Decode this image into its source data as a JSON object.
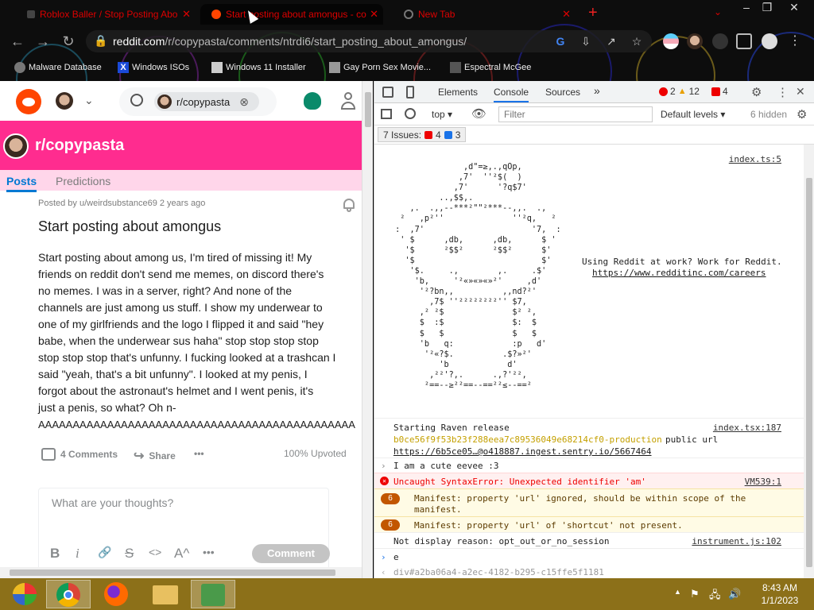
{
  "browser": {
    "tabs": [
      {
        "title": "Roblox Baller / Stop Posting Abo",
        "close": "✕"
      },
      {
        "title": "Start posting about amongus - co",
        "close": "✕"
      },
      {
        "title": "New Tab",
        "close": "✕"
      }
    ],
    "new_tab": "+",
    "window_controls": {
      "minimize": "–",
      "maximize": "❐",
      "close": "✕"
    },
    "tab_search": "⌄",
    "nav": {
      "back": "←",
      "forward": "→",
      "reload": "↻"
    },
    "url_host": "reddit.com",
    "url_path": "/r/copypasta/comments/ntrdi6/start_posting_about_amongus/",
    "bookmarks": [
      {
        "label": "Malware Database"
      },
      {
        "label": "Windows ISOs"
      },
      {
        "label": "Windows 11 Installer"
      },
      {
        "label": "Gay Porn Sex Movie..."
      },
      {
        "label": "Espectral McGee"
      }
    ]
  },
  "reddit": {
    "search_chip": "r/copypasta",
    "search_chip_clear": "⊗",
    "subreddit": "r/copypasta",
    "tabs": [
      {
        "label": "Posts"
      },
      {
        "label": "Predictions"
      }
    ],
    "post_meta": "Posted by u/weirdsubstance69 2 years ago",
    "post_title": "Start posting about amongus",
    "post_body_lines": [
      "Start posting about among us, I'm tired of missing it! My",
      "friends on reddit don't send me memes, on discord there's",
      "no memes. I was in a server, right? And none of the",
      "channels are just among us stuff. I show my underwear to",
      "one of my girlfriends and the logo I flipped it and said \"hey",
      "babe, when the underwear sus haha\" stop stop stop stop",
      "stop stop stop that's unfunny. I fucking looked at a trashcan I",
      "said \"yeah, that's a bit unfunny\". I looked at my penis, I",
      "forgot about the astronaut's helmet and I went penis, it's",
      "just a penis, so what? Oh n-",
      "AAAAAAAAAAAAAAAAAAAAAAAAAAAAAAAAAAAAAAAAAAAAAA"
    ],
    "comments_label": "4 Comments",
    "share_label": "Share",
    "more_label": "•••",
    "upvoted": "100% Upvoted",
    "comment_placeholder": "What are your thoughts?",
    "toolbar": {
      "bold": "B",
      "italic": "i",
      "link": "🔗",
      "strike": "S",
      "code": "<>",
      "superscript": "A^",
      "more": "•••"
    },
    "comment_button": "Comment"
  },
  "devtools": {
    "tabs": [
      {
        "label": "Elements"
      },
      {
        "label": "Console"
      },
      {
        "label": "Sources"
      },
      {
        "label": "»"
      }
    ],
    "badges": {
      "errors": "2",
      "warnings": "12",
      "issues_badge": "4"
    },
    "context": "top",
    "filter_placeholder": "Filter",
    "levels": "Default levels",
    "hidden": "6 hidden",
    "issues_label": "7 Issues:",
    "issues_errors": "4",
    "issues_info": "3",
    "ascii_art": "               ,d\"=≥,.,qOp,\n              ,7'  ''²$(  )\n             ,7'      '?q$7'\n          ..,$$,.\n    ,.  .,,--***²\"\"²***--,,.  .,\n  ²   ,p²''              ''²q,   ²\n :  ,7'                      '7,  :\n  ' $      ,db,      ,db,      $ '\n   '$      ²$$²      ²$$²      $'\n   '$                          $'\n    '$.     .,        ,.     .$'\n     'b,     '²«»«»«»²'     ,d'\n      '²?bn,,          ,,nd?²'\n        ,7$ ''²²²²²²²²'' $7,\n      ,² ²$              $² ²,\n      $  :$              $:  $\n      $   $              $   $\n      'b   q:            :p   d'\n       '²«?$.          .$?»²'\n          'b            d'\n        ,²²'?,.      .,?'²²,\n       ²==--≥²²==--==²²≤--==²",
    "art_source": "index.ts:5",
    "reddit_work": "Using Reddit at work? Work for Reddit.",
    "reddit_careers": "https://www.redditinc.com/careers",
    "raven_label": "Starting Raven release",
    "raven_hash": "b0ce56f9f53b23f288eea7c89536049e68214cf0-production",
    "raven_tail": "public url",
    "raven_url": "https://6b5ce05…@o418887.ingest.sentry.io/5667464",
    "raven_source": "index.tsx:187",
    "input_echo": "I am a cute eevee :3",
    "error_text": "Uncaught SyntaxError: Unexpected identifier 'am'",
    "error_source": "VM539:1",
    "warn1_count": "6",
    "warn1_line1": "Manifest: property 'url' ignored, should be within scope of the",
    "warn1_line2": "manifest.",
    "warn2_count": "6",
    "warn2": "Manifest: property 'url' of 'shortcut' not present.",
    "not_display": "Not display reason: opt_out_or_no_session",
    "not_display_source": "instrument.js:102",
    "prompt_input": "e",
    "autocomplete": "div#a2ba06a4-a2ec-4182-b295-c15ffe5f1181"
  },
  "taskbar": {
    "time": "8:43 AM",
    "date": "1/1/2023",
    "tray_up": "▲"
  },
  "colors": {
    "reddit_orange": "#ff4500",
    "banner_pink": "#ff2c8f",
    "subtab_bg": "#ffd6ea",
    "tab_red": "#dd0000",
    "devtools_error": "#e00000",
    "taskbar": "#8c7019"
  }
}
